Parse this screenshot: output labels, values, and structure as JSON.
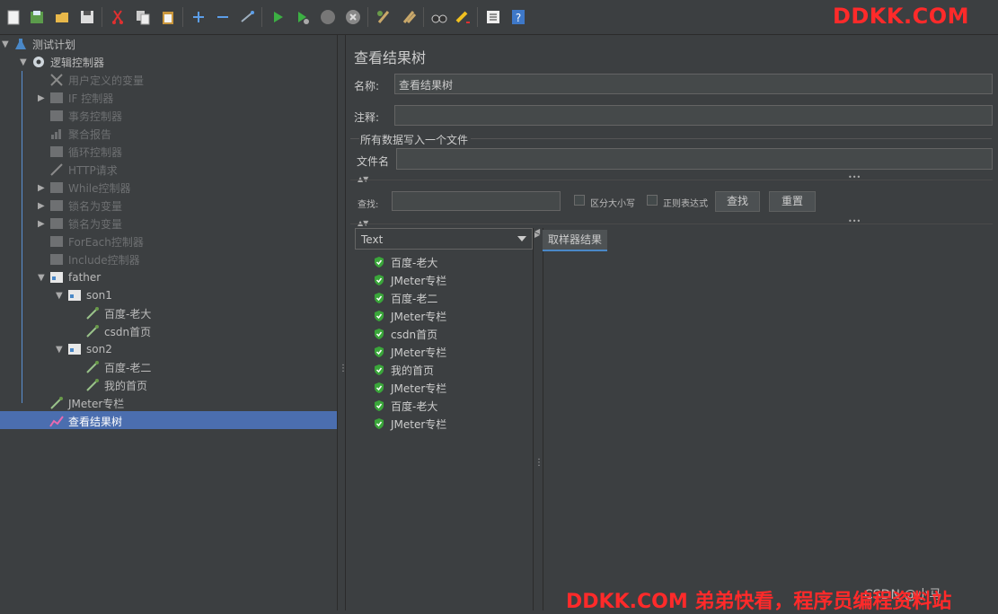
{
  "watermark_top": "DDKK.COM",
  "watermark_bottom": "DDKK.COM 弟弟快看，程序员编程资料站",
  "csdn_mark": "CSDN @小马",
  "toolbar_icons": [
    "new-icon",
    "templates-icon",
    "open-icon",
    "save-icon",
    "cut-icon",
    "copy-icon",
    "paste-icon",
    "expand-icon",
    "collapse-icon",
    "toggle-icon",
    "start-icon",
    "start-no-pause-icon",
    "stop-icon",
    "shutdown-icon",
    "clear-icon",
    "clear-all-icon",
    "search-icon",
    "reset-search-icon",
    "function-helper-icon",
    "help-icon"
  ],
  "tree": {
    "items": [
      {
        "label": "测试计划"
      },
      {
        "label": "逻辑控制器"
      },
      {
        "label": "用户定义的变量"
      },
      {
        "label": "IF 控制器"
      },
      {
        "label": "事务控制器"
      },
      {
        "label": "聚合报告"
      },
      {
        "label": "循环控制器"
      },
      {
        "label": "HTTP请求"
      },
      {
        "label": "While控制器"
      },
      {
        "label": "锁名为变量"
      },
      {
        "label": "锁名为变量"
      },
      {
        "label": "ForEach控制器"
      },
      {
        "label": "Include控制器"
      },
      {
        "label": "father"
      },
      {
        "label": "son1"
      },
      {
        "label": "百度-老大"
      },
      {
        "label": "csdn首页"
      },
      {
        "label": "son2"
      },
      {
        "label": "百度-老二"
      },
      {
        "label": "我的首页"
      },
      {
        "label": "JMeter专栏"
      },
      {
        "label": "查看结果树"
      }
    ]
  },
  "panel": {
    "title": "查看结果树",
    "name_label": "名称:",
    "name_value": "查看结果树",
    "comment_label": "注释:",
    "comment_value": "",
    "group_label": "所有数据写入一个文件",
    "filename_label": "文件名",
    "filename_value": "",
    "search_label": "查找:",
    "case_label": "区分大小写",
    "regex_label": "正则表达式",
    "search_button": "查找",
    "reset_button": "重置"
  },
  "results": {
    "renderer": "Text",
    "items": [
      "百度-老大",
      "JMeter专栏",
      "百度-老二",
      "JMeter专栏",
      "csdn首页",
      "JMeter专栏",
      "我的首页",
      "JMeter专栏",
      "百度-老大",
      "JMeter专栏"
    ],
    "tab_label": "取样器结果"
  },
  "colors": {
    "accent": "#4b6eaf",
    "success": "#3aa63a",
    "watermark": "#ff2a2a"
  }
}
